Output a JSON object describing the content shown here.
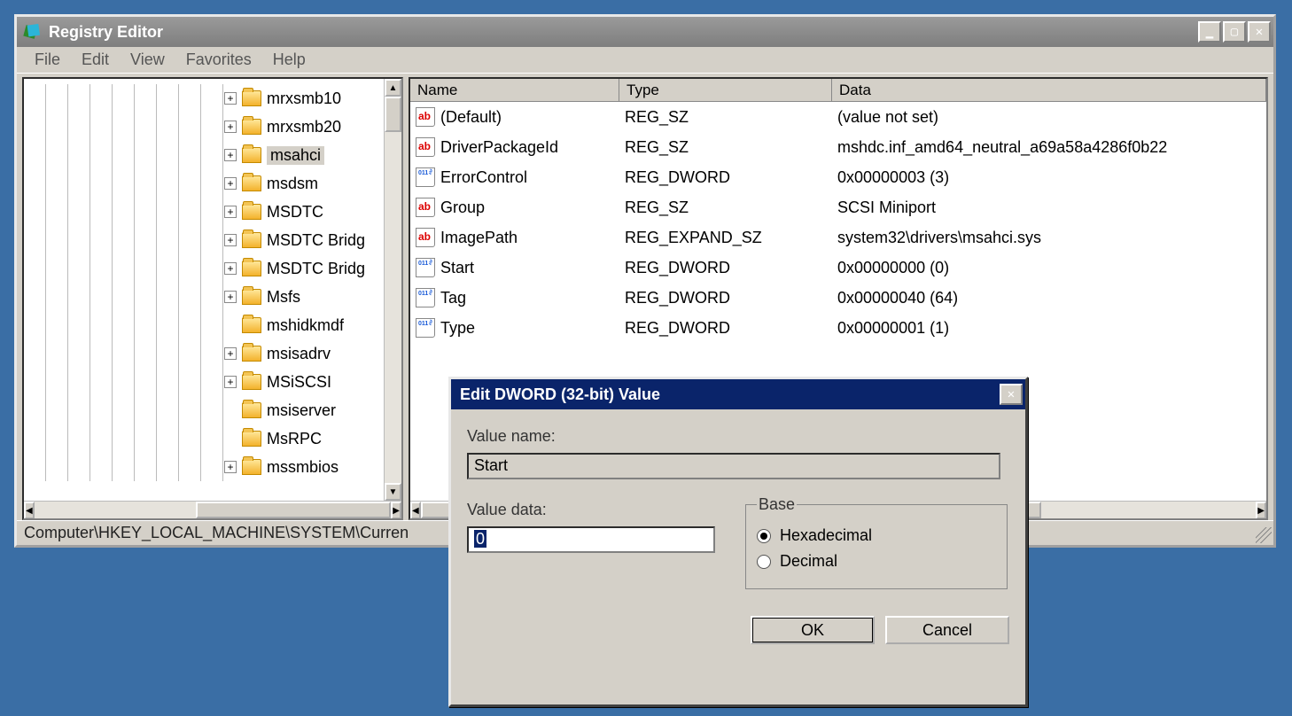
{
  "window": {
    "title": "Registry Editor",
    "menus": [
      "File",
      "Edit",
      "View",
      "Favorites",
      "Help"
    ]
  },
  "tree": {
    "items": [
      {
        "label": "mrxsmb10",
        "expander": true,
        "selected": false
      },
      {
        "label": "mrxsmb20",
        "expander": true,
        "selected": false
      },
      {
        "label": "msahci",
        "expander": true,
        "selected": true
      },
      {
        "label": "msdsm",
        "expander": true,
        "selected": false
      },
      {
        "label": "MSDTC",
        "expander": true,
        "selected": false
      },
      {
        "label": "MSDTC Bridg",
        "expander": true,
        "selected": false
      },
      {
        "label": "MSDTC Bridg",
        "expander": true,
        "selected": false
      },
      {
        "label": "Msfs",
        "expander": true,
        "selected": false
      },
      {
        "label": "mshidkmdf",
        "expander": false,
        "selected": false
      },
      {
        "label": "msisadrv",
        "expander": true,
        "selected": false
      },
      {
        "label": "MSiSCSI",
        "expander": true,
        "selected": false
      },
      {
        "label": "msiserver",
        "expander": false,
        "selected": false
      },
      {
        "label": "MsRPC",
        "expander": false,
        "selected": false
      },
      {
        "label": "mssmbios",
        "expander": true,
        "selected": false
      }
    ]
  },
  "columns": {
    "name": "Name",
    "type": "Type",
    "data": "Data"
  },
  "values": [
    {
      "icon": "sz",
      "name": "(Default)",
      "type": "REG_SZ",
      "data": "(value not set)"
    },
    {
      "icon": "sz",
      "name": "DriverPackageId",
      "type": "REG_SZ",
      "data": "mshdc.inf_amd64_neutral_a69a58a4286f0b22"
    },
    {
      "icon": "dw",
      "name": "ErrorControl",
      "type": "REG_DWORD",
      "data": "0x00000003 (3)"
    },
    {
      "icon": "sz",
      "name": "Group",
      "type": "REG_SZ",
      "data": "SCSI Miniport"
    },
    {
      "icon": "sz",
      "name": "ImagePath",
      "type": "REG_EXPAND_SZ",
      "data": "system32\\drivers\\msahci.sys"
    },
    {
      "icon": "dw",
      "name": "Start",
      "type": "REG_DWORD",
      "data": "0x00000000 (0)"
    },
    {
      "icon": "dw",
      "name": "Tag",
      "type": "REG_DWORD",
      "data": "0x00000040 (64)"
    },
    {
      "icon": "dw",
      "name": "Type",
      "type": "REG_DWORD",
      "data": "0x00000001 (1)"
    }
  ],
  "statusbar": "Computer\\HKEY_LOCAL_MACHINE\\SYSTEM\\Curren",
  "dialog": {
    "title": "Edit DWORD (32-bit) Value",
    "label_name": "Value name:",
    "value_name": "Start",
    "label_data": "Value data:",
    "value_data": "0",
    "base_legend": "Base",
    "radio_hex": "Hexadecimal",
    "radio_dec": "Decimal",
    "ok": "OK",
    "cancel": "Cancel",
    "base_selected": "hex"
  }
}
